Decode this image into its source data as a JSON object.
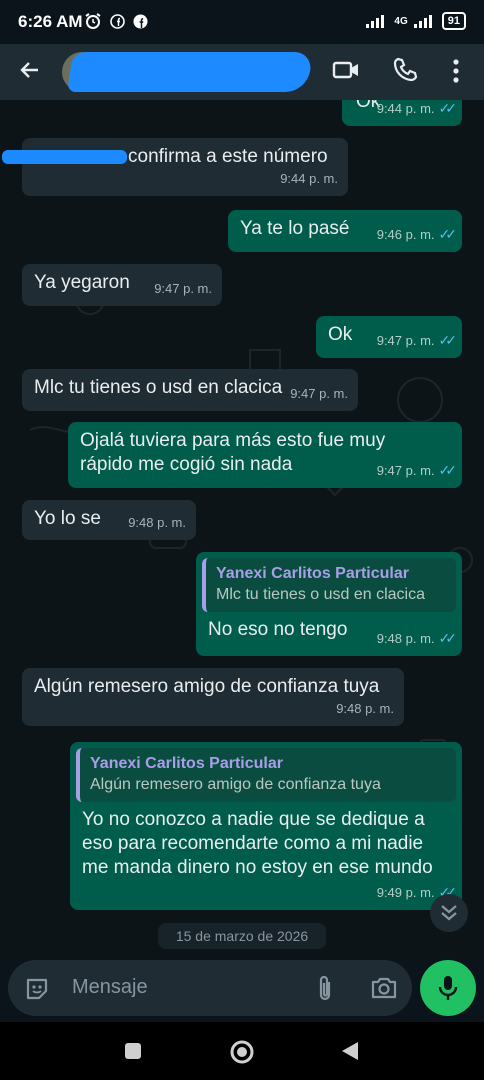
{
  "status_bar": {
    "time": "6:26 AM",
    "network": "4G",
    "battery": "91",
    "icons": [
      "alarm-icon",
      "facebook-icon",
      "facebook-icon",
      "signal-icon",
      "wifi-icon",
      "battery-icon"
    ]
  },
  "header": {
    "icons": [
      "back-arrow-icon",
      "video-call-icon",
      "voice-call-icon",
      "more-vert-icon"
    ]
  },
  "messages": [
    {
      "dir": "out",
      "text": "Ok",
      "time": "9:44 p. m."
    },
    {
      "dir": "in",
      "text": "confirma a este número",
      "time": "9:44 p. m."
    },
    {
      "dir": "out",
      "text": "Ya te lo pasé",
      "time": "9:46 p. m."
    },
    {
      "dir": "in",
      "text": "Ya yegaron",
      "time": "9:47 p. m."
    },
    {
      "dir": "out",
      "text": "Ok",
      "time": "9:47 p. m."
    },
    {
      "dir": "in",
      "text": "Mlc tu tienes o usd en clacica",
      "time": "9:47 p. m."
    },
    {
      "dir": "out",
      "text": "Ojalá tuviera para más esto fue muy rápido me cogió sin nada",
      "time": "9:47 p. m."
    },
    {
      "dir": "in",
      "text": "Yo lo se",
      "time": "9:48 p. m."
    },
    {
      "dir": "out",
      "quote_name": "Yanexi Carlitos Particular",
      "quote_text": "Mlc tu tienes o usd en clacica",
      "text": "No eso no tengo",
      "time": "9:48 p. m."
    },
    {
      "dir": "in",
      "text": "Algún remesero amigo de confianza tuya",
      "time": "9:48 p. m."
    },
    {
      "dir": "out",
      "quote_name": "Yanexi Carlitos Particular",
      "quote_text": "Algún remesero amigo de confianza tuya",
      "text": "Yo no conozco a nadie que se dedique a eso para recomendarte como a mi nadie me manda dinero no estoy en ese mundo",
      "time": "9:49 p. m."
    }
  ],
  "date_chip": "15 de marzo de 2026",
  "composer": {
    "placeholder": "Mensaje",
    "icons": [
      "sticker-icon",
      "attach-icon",
      "camera-icon",
      "mic-icon"
    ]
  },
  "navbar": {
    "icons": [
      "recents-icon",
      "home-icon",
      "back-icon"
    ]
  },
  "colors": {
    "incoming": "#1f2c34",
    "outgoing": "#005c4b",
    "accent": "#21c063",
    "read_tick": "#53bdeb"
  }
}
